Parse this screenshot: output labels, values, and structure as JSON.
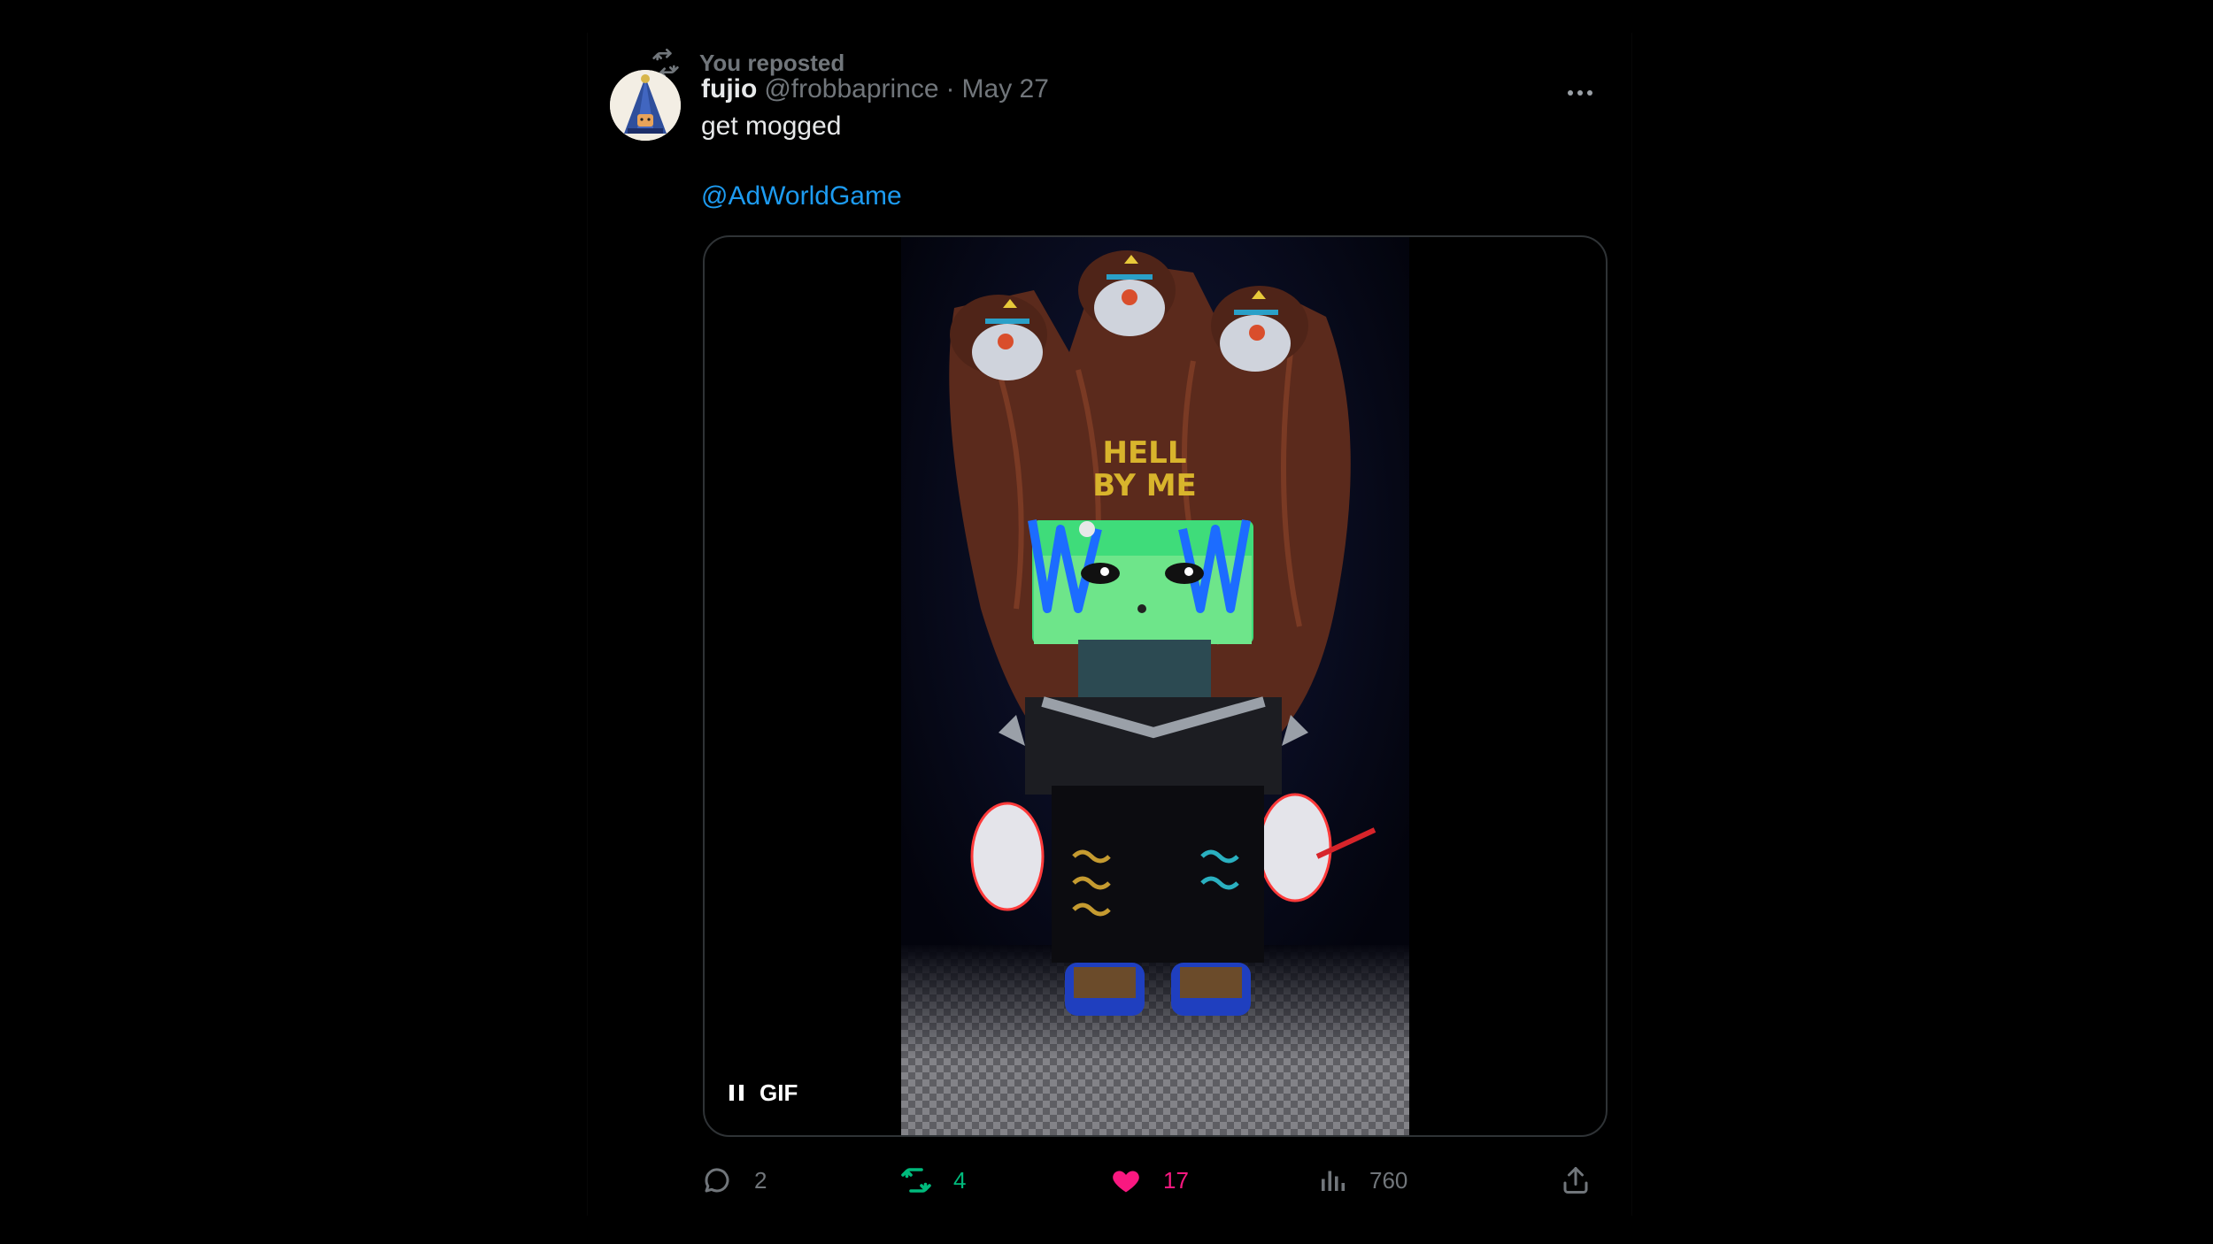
{
  "repost_banner": {
    "icon": "repost-icon",
    "label": "You reposted"
  },
  "author": {
    "name": "fujio",
    "handle": "@frobbaprince",
    "separator": "·",
    "date": "May 27",
    "avatar": "avatar-image"
  },
  "tweet": {
    "text": "get mogged",
    "mention": "@AdWorldGame"
  },
  "media": {
    "type": "gif",
    "gif_label": "GIF",
    "pause_icon": "pause-icon",
    "sign_text": [
      "HELL",
      "BY ME"
    ]
  },
  "actions": {
    "reply": {
      "icon": "reply-icon",
      "count": "2"
    },
    "retweet": {
      "icon": "retweet-icon",
      "count": "4",
      "color": "#00ba7c"
    },
    "like": {
      "icon": "heart-icon",
      "count": "17",
      "color": "#f91880"
    },
    "views": {
      "icon": "views-icon",
      "count": "760"
    },
    "share": {
      "icon": "share-icon"
    }
  },
  "colors": {
    "background": "#000000",
    "text": "#e7e9ea",
    "secondary": "#71767b",
    "link": "#1d9bf0"
  }
}
